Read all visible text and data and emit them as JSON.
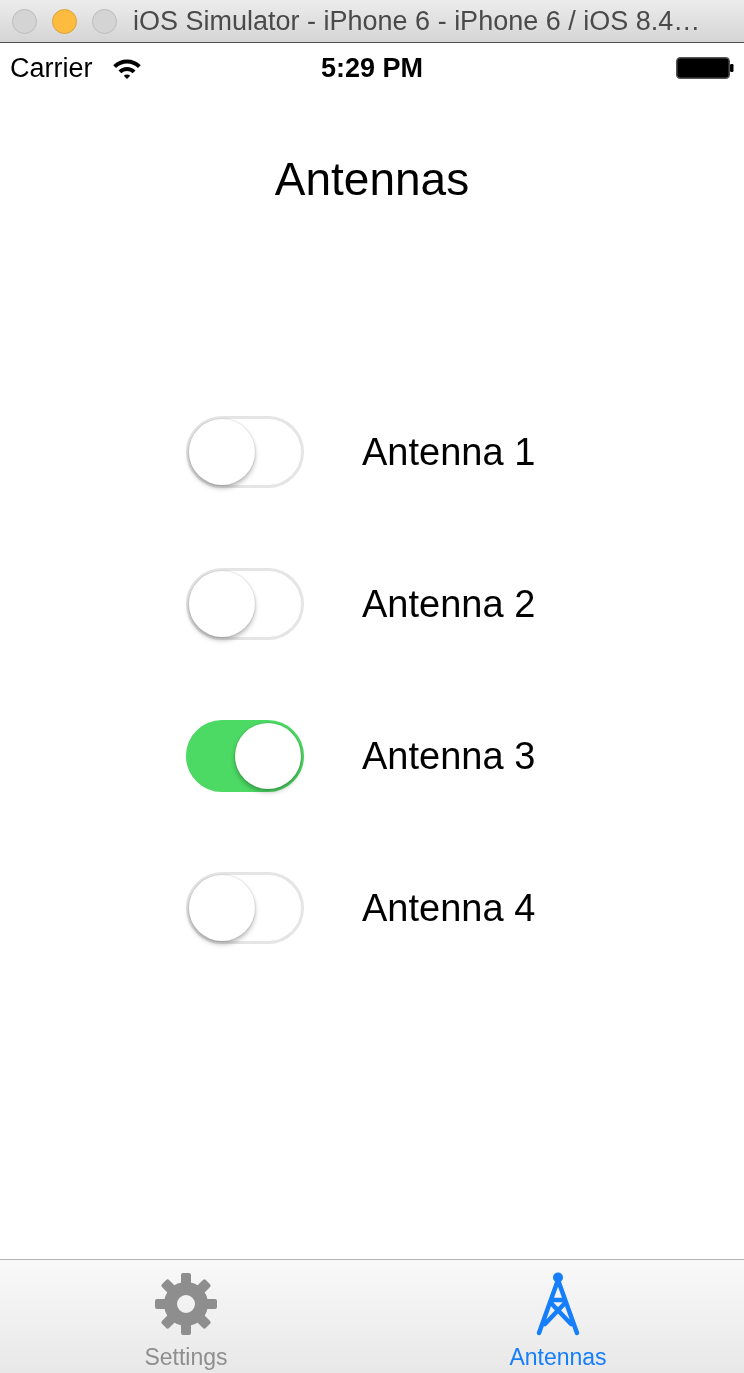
{
  "window": {
    "title": "iOS Simulator - iPhone 6 - iPhone 6 / iOS 8.4…",
    "buttons": [
      {
        "color": "#d4d4d4"
      },
      {
        "color": "#fdbc40"
      },
      {
        "color": "#d4d4d4"
      }
    ]
  },
  "status_bar": {
    "carrier": "Carrier",
    "time": "5:29 PM"
  },
  "screen_title": "Antennas",
  "antennas": [
    {
      "label": "Antenna 1",
      "on": false
    },
    {
      "label": "Antenna 2",
      "on": false
    },
    {
      "label": "Antenna 3",
      "on": true
    },
    {
      "label": "Antenna 4",
      "on": false
    }
  ],
  "tab_bar": {
    "tabs": [
      {
        "label": "Settings",
        "kind": "gear",
        "selected": false
      },
      {
        "label": "Antennas",
        "kind": "tower",
        "selected": true
      }
    ]
  }
}
